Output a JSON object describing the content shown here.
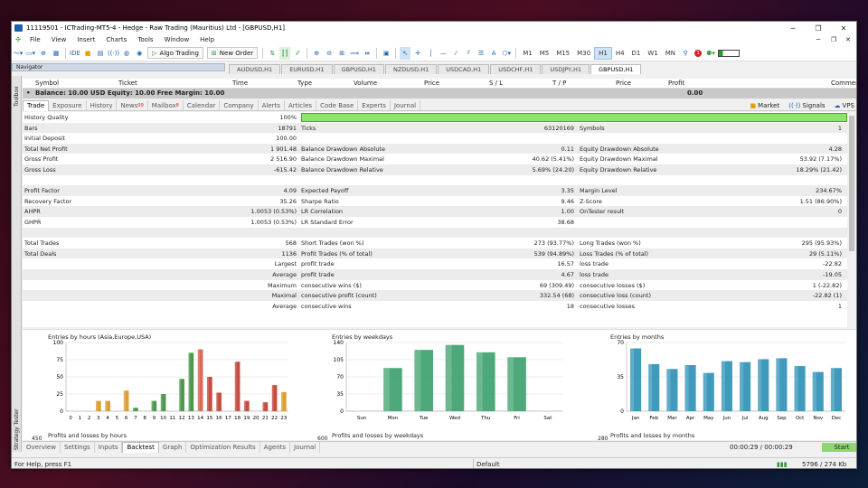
{
  "window": {
    "title": "11119501 - ICTrading-MT5-4 - Hedge - Raw Trading (Mauritius) Ltd - [GBPUSD,H1]"
  },
  "menu": [
    "File",
    "View",
    "Insert",
    "Charts",
    "Tools",
    "Window",
    "Help"
  ],
  "toolbar": {
    "ide": "IDE",
    "algo_label": "Algo Trading",
    "new_order_label": "New Order",
    "timeframes": [
      "M1",
      "M5",
      "M15",
      "M30",
      "H1",
      "H4",
      "D1",
      "W1",
      "MN"
    ],
    "selected_tf": "H1",
    "notif_count": "1"
  },
  "navigator": {
    "title": "Navigator"
  },
  "chart_tabs": [
    "AUDUSD,H1",
    "EURUSD,H1",
    "GBPUSD,H1",
    "NZDUSD,H1",
    "USDCAD,H1",
    "USDCHF,H1",
    "USDJPY,H1",
    "GBPUSD,H1"
  ],
  "active_chart_tab": 7,
  "toolbox": {
    "label": "Toolbox",
    "headers": [
      "Symbol",
      "Ticket",
      "Time",
      "Type",
      "Volume",
      "Price",
      "S / L",
      "T / P",
      "Price",
      "Profit",
      "Comment"
    ],
    "balance_text": "Balance: 10.00 USD  Equity: 10.00  Free Margin: 10.00",
    "balance_profit": "0.00",
    "tabs": [
      {
        "label": "Trade",
        "badge": ""
      },
      {
        "label": "Exposure",
        "badge": ""
      },
      {
        "label": "History",
        "badge": ""
      },
      {
        "label": "News",
        "badge": "99"
      },
      {
        "label": "Mailbox",
        "badge": "8"
      },
      {
        "label": "Calendar",
        "badge": ""
      },
      {
        "label": "Company",
        "badge": ""
      },
      {
        "label": "Alerts",
        "badge": ""
      },
      {
        "label": "Articles",
        "badge": ""
      },
      {
        "label": "Code Base",
        "badge": ""
      },
      {
        "label": "Experts",
        "badge": ""
      },
      {
        "label": "Journal",
        "badge": ""
      }
    ],
    "right_links": [
      "Market",
      "Signals",
      "VPS"
    ]
  },
  "report": {
    "history_quality": {
      "label": "History Quality",
      "value": "100%",
      "fill": 1.0
    },
    "rows": [
      {
        "l1": "Bars",
        "v1": "18791",
        "l2": "Ticks",
        "v2": "63120169",
        "l3": "Symbols",
        "v3": "1"
      },
      {
        "l1": "Initial Deposit",
        "v1": "100.00",
        "l2": "",
        "v2": "",
        "l3": "",
        "v3": ""
      },
      {
        "l1": "Total Net Profit",
        "v1": "1 901.48",
        "l2": "Balance Drawdown Absolute",
        "v2": "0.11",
        "l3": "Equity Drawdown Absolute",
        "v3": "4.28"
      },
      {
        "l1": "Gross Profit",
        "v1": "2 516.90",
        "l2": "Balance Drawdown Maximal",
        "v2": "40.62 (5.41%)",
        "l3": "Equity Drawdown Maximal",
        "v3": "53.92 (7.17%)"
      },
      {
        "l1": "Gross Loss",
        "v1": "-615.42",
        "l2": "Balance Drawdown Relative",
        "v2": "5.69% (24.20)",
        "l3": "Equity Drawdown Relative",
        "v3": "18.29% (21.42)"
      },
      {
        "l1": "",
        "v1": "",
        "l2": "",
        "v2": "",
        "l3": "",
        "v3": ""
      },
      {
        "l1": "Profit Factor",
        "v1": "4.09",
        "l2": "Expected Payoff",
        "v2": "3.35",
        "l3": "Margin Level",
        "v3": "234.67%"
      },
      {
        "l1": "Recovery Factor",
        "v1": "35.26",
        "l2": "Sharpe Ratio",
        "v2": "9.46",
        "l3": "Z-Score",
        "v3": "1.51 (86.90%)"
      },
      {
        "l1": "AHPR",
        "v1": "1.0053 (0.53%)",
        "l2": "LR Correlation",
        "v2": "1.00",
        "l3": "OnTester result",
        "v3": "0"
      },
      {
        "l1": "GHPR",
        "v1": "1.0053 (0.53%)",
        "l2": "LR Standard Error",
        "v2": "38.68",
        "l3": "",
        "v3": ""
      },
      {
        "l1": "",
        "v1": "",
        "l2": "",
        "v2": "",
        "l3": "",
        "v3": ""
      },
      {
        "l1": "Total Trades",
        "v1": "568",
        "l2": "Short Trades (won %)",
        "v2": "273 (93.77%)",
        "l3": "Long Trades (won %)",
        "v3": "295 (95.93%)"
      },
      {
        "l1": "Total Deals",
        "v1": "1136",
        "l2": "Profit Trades (% of total)",
        "v2": "539 (94.89%)",
        "l3": "Loss Trades (% of total)",
        "v3": "29 (5.11%)"
      },
      {
        "l1": "",
        "v1": "Largest",
        "l2": "profit trade",
        "v2": "16.57",
        "l3": "loss trade",
        "v3": "-22.82"
      },
      {
        "l1": "",
        "v1": "Average",
        "l2": "profit trade",
        "v2": "4.67",
        "l3": "loss trade",
        "v3": "-19.05"
      },
      {
        "l1": "",
        "v1": "Maximum",
        "l2": "consecutive wins ($)",
        "v2": "69 (309.49)",
        "l3": "consecutive losses ($)",
        "v3": "1 (-22.82)"
      },
      {
        "l1": "",
        "v1": "Maximal",
        "l2": "consecutive profit (count)",
        "v2": "332.54 (68)",
        "l3": "consecutive loss (count)",
        "v3": "-22.82 (1)"
      },
      {
        "l1": "",
        "v1": "Average",
        "l2": "consecutive wins",
        "v2": "18",
        "l3": "consecutive losses",
        "v3": "1"
      }
    ]
  },
  "chart_data": [
    {
      "type": "bar",
      "title": "Entries by hours (Asia,Europe,USA)",
      "bottom_title": "Profits and losses by hours",
      "bottom_tick": "450",
      "ylim": [
        0,
        100
      ],
      "yticks": [
        "0",
        "25",
        "50",
        "75",
        "100"
      ],
      "categories": [
        "0",
        "1",
        "2",
        "3",
        "4",
        "5",
        "6",
        "7",
        "8",
        "9",
        "10",
        "11",
        "12",
        "13",
        "14",
        "15",
        "16",
        "17",
        "18",
        "19",
        "20",
        "21",
        "22",
        "23"
      ],
      "values": [
        0,
        0,
        0,
        15,
        15,
        0,
        30,
        5,
        0,
        15,
        25,
        0,
        47,
        85,
        90,
        50,
        27,
        0,
        72,
        15,
        0,
        13,
        38,
        28
      ],
      "colors": [
        "#3a8d3a",
        "#3a8d3a",
        "#3a8d3a",
        "#d9951e",
        "#d9951e",
        "#d9951e",
        "#d9951e",
        "#3a8d3a",
        "#3a8d3a",
        "#3a8d3a",
        "#3a8d3a",
        "#3a8d3a",
        "#3a8d3a",
        "#3a8d3a",
        "#d65a40",
        "#c0392b",
        "#c0392b",
        "#c0392b",
        "#c0392b",
        "#c0392b",
        "#c0392b",
        "#c0392b",
        "#c0392b",
        "#d9951e"
      ]
    },
    {
      "type": "bar",
      "title": "Entries by weekdays",
      "bottom_title": "Profits and losses by weekdays",
      "bottom_tick": "600",
      "ylim": [
        0,
        140
      ],
      "yticks": [
        "0",
        "35",
        "70",
        "105",
        "140"
      ],
      "categories": [
        "Sun",
        "Mon",
        "Tue",
        "Wed",
        "Thu",
        "Fri",
        "Sat"
      ],
      "values": [
        0,
        88,
        125,
        135,
        120,
        110,
        0
      ],
      "color": "#3aa06a"
    },
    {
      "type": "bar",
      "title": "Entries by months",
      "bottom_title": "Profits and losses by months",
      "bottom_tick": "280",
      "ylim": [
        0,
        70
      ],
      "yticks": [
        "0",
        "35",
        "70"
      ],
      "categories": [
        "Jan",
        "Feb",
        "Mar",
        "Apr",
        "May",
        "Jun",
        "Jul",
        "Aug",
        "Sep",
        "Oct",
        "Nov",
        "Dec"
      ],
      "values": [
        64,
        48,
        43,
        47,
        39,
        51,
        50,
        53,
        54,
        46,
        40,
        44
      ],
      "color": "#2a8fb5"
    }
  ],
  "tester": {
    "label": "Strategy Tester",
    "tabs": [
      "Overview",
      "Settings",
      "Inputs",
      "Backtest",
      "Graph",
      "Optimization Results",
      "Agents",
      "Journal"
    ],
    "active_tab": "Backtest",
    "timer": "00:00:29 / 00:00:29",
    "start_label": "Start"
  },
  "status": {
    "help": "For Help, press F1",
    "profile": "Default",
    "traffic": "5796 / 274 Kb"
  }
}
